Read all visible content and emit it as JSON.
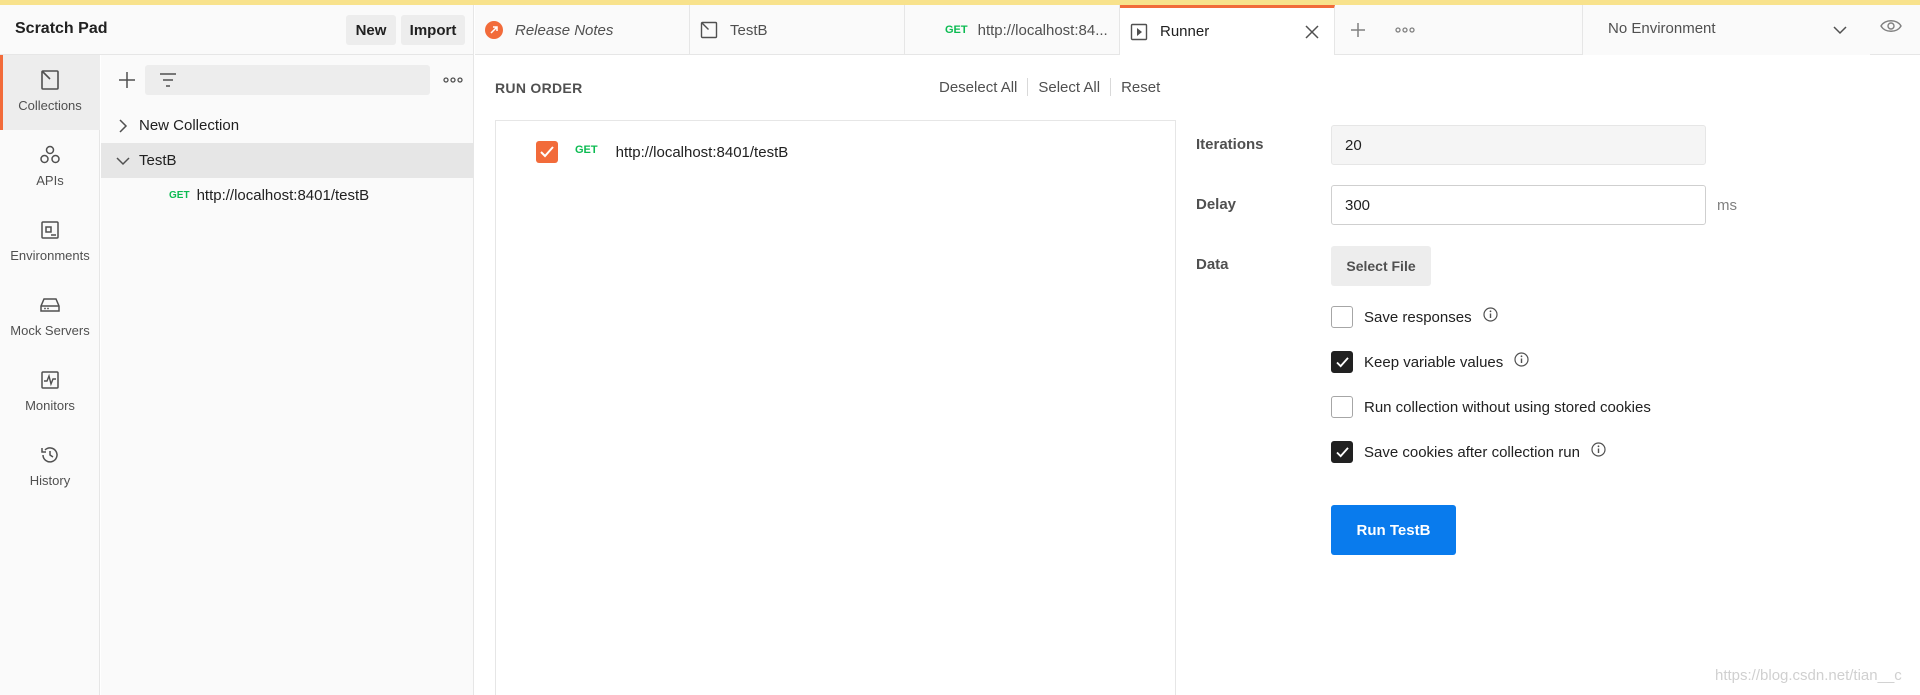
{
  "app": {
    "workspace_title": "Scratch Pad",
    "new_label": "New",
    "import_label": "Import"
  },
  "rail": {
    "items": [
      {
        "label": "Collections",
        "icon": "collections-icon",
        "active": true
      },
      {
        "label": "APIs",
        "icon": "apis-icon"
      },
      {
        "label": "Environments",
        "icon": "environments-icon"
      },
      {
        "label": "Mock Servers",
        "icon": "mock-servers-icon"
      },
      {
        "label": "Monitors",
        "icon": "monitors-icon"
      },
      {
        "label": "History",
        "icon": "history-icon"
      }
    ]
  },
  "sidebar": {
    "filter_placeholder": "",
    "collections": [
      {
        "name": "New Collection",
        "expanded": false
      },
      {
        "name": "TestB",
        "expanded": true,
        "selected": true
      }
    ],
    "request": {
      "method": "GET",
      "url": "http://localhost:8401/testB"
    }
  },
  "tabs": [
    {
      "label": "Release Notes",
      "icon": "release-notes-icon"
    },
    {
      "label": "TestB",
      "icon": "collection-tab-icon"
    },
    {
      "method": "GET",
      "label": "http://localhost:84..."
    },
    {
      "label": "Runner",
      "icon": "runner-icon",
      "active": true
    }
  ],
  "environment": {
    "selected": "No Environment"
  },
  "runner": {
    "run_order_label": "RUN ORDER",
    "deselect_all": "Deselect All",
    "select_all": "Select All",
    "reset": "Reset",
    "request": {
      "method": "GET",
      "url": "http://localhost:8401/testB",
      "checked": true
    },
    "iterations_label": "Iterations",
    "iterations_value": "20",
    "delay_label": "Delay",
    "delay_value": "300",
    "delay_unit": "ms",
    "data_label": "Data",
    "select_file": "Select File",
    "options": [
      {
        "label": "Save responses",
        "checked": false,
        "info": true
      },
      {
        "label": "Keep variable values",
        "checked": true,
        "info": true
      },
      {
        "label": "Run collection without using stored cookies",
        "checked": false,
        "info": false
      },
      {
        "label": "Save cookies after collection run",
        "checked": true,
        "info": true
      }
    ],
    "run_button": "Run TestB"
  },
  "watermark": "https://blog.csdn.net/tian__c",
  "colors": {
    "accent": "#f26b3a",
    "primary_button": "#097bed",
    "get_method": "#0cbb52"
  }
}
